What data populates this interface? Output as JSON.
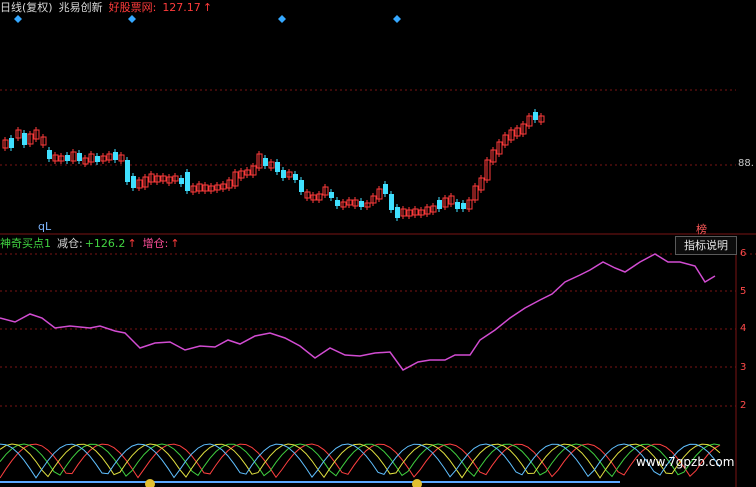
{
  "header": {
    "period": "日线(复权)",
    "stock_name": "兆易创新",
    "site": "好股票网:",
    "value": "127.17",
    "arrow": "↑"
  },
  "indicator_bar": {
    "name": "神奇买点1",
    "reduce_label": "减仓:",
    "reduce_value": "+126.2",
    "reduce_arrow": "↑",
    "add_label": "增仓:",
    "add_arrow": "↑"
  },
  "ql_label": "qL",
  "explain_button": "指标说明",
  "bang_label": "榜",
  "price_axis": {
    "label": "88."
  },
  "right_axis_labels": [
    "6",
    "5",
    "4",
    "3",
    "2"
  ],
  "watermark": "www.7gpzb.com",
  "colors": {
    "up": "#ff3b3b",
    "down": "#40e0ff",
    "line": "#d24cd2",
    "grid": "#7a1414"
  }
}
